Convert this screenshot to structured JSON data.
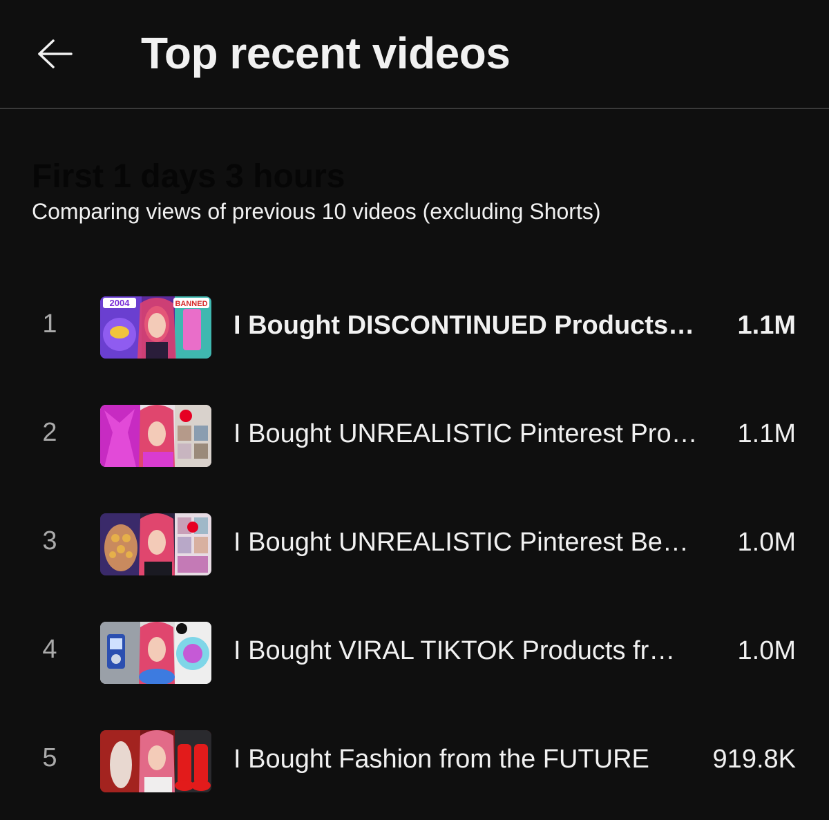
{
  "header": {
    "back_icon": "arrow-left-icon",
    "title": "Top recent videos"
  },
  "section": {
    "heading": "First 1 days 3 hours",
    "subtitle": "Comparing views of previous 10 videos (excluding Shorts)"
  },
  "videos": [
    {
      "rank": "1",
      "title": "I Bought DISCONTINUED Products…",
      "views": "1.1M",
      "thumbnail_text_left": "2004",
      "thumbnail_text_right": "BANNED"
    },
    {
      "rank": "2",
      "title": "I Bought UNREALISTIC Pinterest Pro…",
      "views": "1.1M"
    },
    {
      "rank": "3",
      "title": "I Bought UNREALISTIC Pinterest Be…",
      "views": "1.0M"
    },
    {
      "rank": "4",
      "title": "I Bought VIRAL TIKTOK Products fr…",
      "views": "1.0M"
    },
    {
      "rank": "5",
      "title": "I Bought Fashion from the FUTURE",
      "views": "919.8K"
    }
  ],
  "colors": {
    "background": "#0f0f0f",
    "text": "#f1f1f1",
    "rank": "#aaaaaa",
    "divider": "#3a3a3a"
  }
}
